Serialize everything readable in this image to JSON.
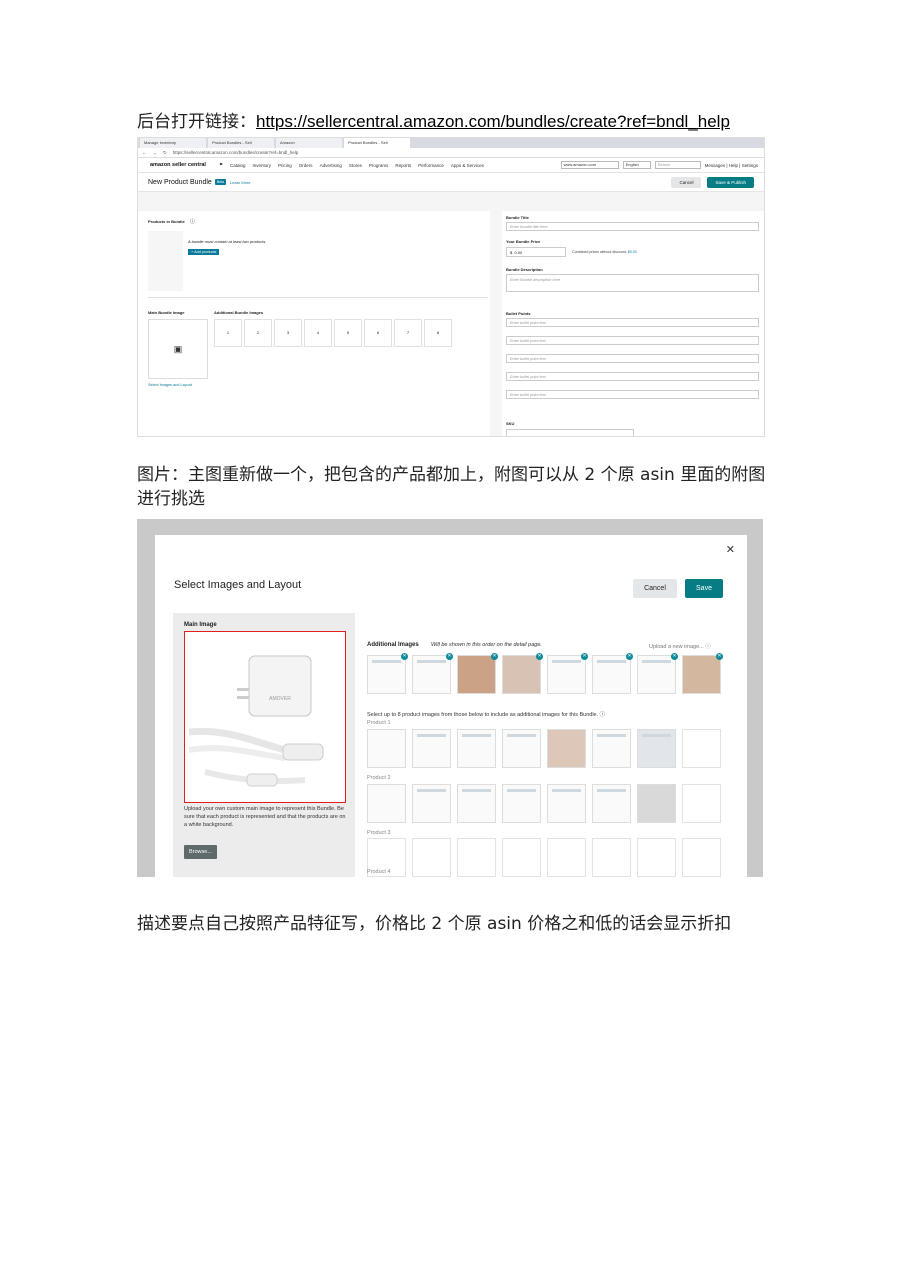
{
  "para1": {
    "text": "后台打开链接：",
    "link": "https://sellercentral.amazon.com/bundles/create?ref=bndl_help"
  },
  "para2": "图片：主图重新做一个，把包含的产品都加上，附图可以从 2 个原 asin 里面的附图进行挑选",
  "para3": "描述要点自己按照产品特征写，价格比 2 个原 asin 价格之和低的话会显示折扣",
  "shot1": {
    "tabs": [
      "Manage Inventory",
      "Product Bundles - Sell",
      "Amazon",
      "Product Bundles - Sell"
    ],
    "url": "https://sellercentral.amazon.com/bundles/create?ref=bndl_help",
    "logo": "amazon seller central",
    "nav": [
      "Catalog",
      "Inventory",
      "Pricing",
      "Orders",
      "Advertising",
      "Stores",
      "Programs",
      "Reports",
      "Performance",
      "Apps & Services"
    ],
    "marketplace": "www.amazon.com",
    "language": "English",
    "search_placeholder": "Search",
    "header_links": "Messages | Help | Settings",
    "page_title": "New Product Bundle",
    "beta": "Beta",
    "learn_more": "Learn More",
    "cancel": "Cancel",
    "save_publish": "Save & Publish",
    "products_in_bundle": "Products in Bundle",
    "bundle_note": "A bundle must contain at least two products.",
    "add_products": "+ Add products",
    "main_bundle_image": "Main Bundle Image",
    "additional_bundle_images": "Additional Bundle Images",
    "slots": [
      "1",
      "2",
      "3",
      "4",
      "5",
      "6",
      "7",
      "8"
    ],
    "select_images": "Select Images and Layout",
    "bundle_title": "Bundle Title",
    "bundle_title_ph": "Enter Bundle title here",
    "your_bundle_price": "Your Bundle Price",
    "currency": "$",
    "price": "0.00",
    "combined_note": "Combined prices without discount:",
    "combined_value": "$0.00",
    "bundle_description": "Bundle Description",
    "description_ph": "Enter Bundle description here",
    "bullet_points": "Bullet Points",
    "bullet_ph": [
      "Enter bullet point text",
      "Enter bullet point text",
      "Enter bullet point text",
      "Enter bullet point text",
      "Enter bullet point text"
    ],
    "sku": "SKU"
  },
  "shot2": {
    "title": "Select Images and Layout",
    "cancel": "Cancel",
    "save": "Save",
    "main_image": "Main Image",
    "brand": "AMOVER",
    "main_text": "Upload your own custom main image to represent this Bundle. Be sure that each product is represented and that the products are on a white background.",
    "browse": "Browse...",
    "additional_images": "Additional Images",
    "additional_note": "Will be shown in this order on the detail page.",
    "upload_link": "Upload a new image...",
    "select_note": "Select up to 8 product images from those below to include as additional images for this Bundle.",
    "products": [
      "Product 1",
      "Product 2",
      "Product 3",
      "Product 4"
    ]
  }
}
